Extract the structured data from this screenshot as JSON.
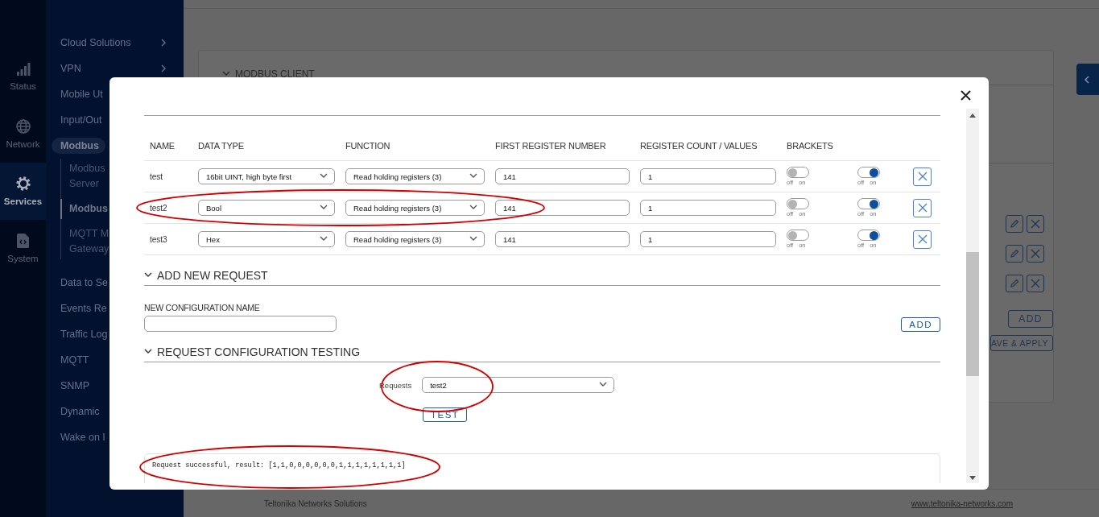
{
  "rail": [
    {
      "label": "Status",
      "selected": false
    },
    {
      "label": "Network",
      "selected": false
    },
    {
      "label": "Services",
      "selected": true
    },
    {
      "label": "System",
      "selected": false
    }
  ],
  "sidebar": {
    "items": [
      {
        "label": "Cloud Solutions",
        "expandable": true,
        "selected": false
      },
      {
        "label": "VPN",
        "expandable": true,
        "selected": false
      },
      {
        "label": "Mobile Ut",
        "selected": false
      },
      {
        "label": "Input/Out",
        "selected": false
      },
      {
        "label": "Modbus",
        "selected": true,
        "children": [
          {
            "label": "Modbus\nServer",
            "selected": false
          },
          {
            "label": "Modbus",
            "selected": true
          },
          {
            "label": "MQTT M\nGateway",
            "selected": false
          }
        ]
      },
      {
        "label": "Data to Se",
        "selected": false
      },
      {
        "label": "Events Re",
        "selected": false
      },
      {
        "label": "Traffic Log",
        "selected": false
      },
      {
        "label": "MQTT",
        "selected": false
      },
      {
        "label": "SNMP",
        "selected": false
      },
      {
        "label": "Dynamic",
        "selected": false
      },
      {
        "label": "Wake on I",
        "selected": false
      }
    ]
  },
  "background_page": {
    "section_title": "MODBUS CLIENT",
    "buttons": [
      "ADD",
      "AVE & APPLY"
    ]
  },
  "footer": {
    "company": "Teltonika Networks Solutions",
    "link": "www.teltonika-networks.com"
  },
  "modal": {
    "table": {
      "columns": [
        "NAME",
        "DATA TYPE",
        "FUNCTION",
        "FIRST REGISTER NUMBER",
        "REGISTER COUNT / VALUES",
        "BRACKETS"
      ],
      "rows": [
        {
          "name": "test",
          "data_type": "16bit UINT, high byte first",
          "function": "Read holding registers (3)",
          "first_register": "141",
          "register_count": "1",
          "brackets": {
            "on": false,
            "off_label": "off",
            "on_label": "on"
          },
          "enabled": {
            "on": true,
            "off_label": "off",
            "on_label": "on"
          }
        },
        {
          "name": "test2",
          "data_type": "Bool",
          "function": "Read holding registers (3)",
          "first_register": "141",
          "register_count": "1",
          "brackets": {
            "on": false,
            "off_label": "off",
            "on_label": "on"
          },
          "enabled": {
            "on": true,
            "off_label": "off",
            "on_label": "on"
          }
        },
        {
          "name": "test3",
          "data_type": "Hex",
          "function": "Read holding registers (3)",
          "first_register": "141",
          "register_count": "1",
          "brackets": {
            "on": false,
            "off_label": "off",
            "on_label": "on"
          },
          "enabled": {
            "on": true,
            "off_label": "off",
            "on_label": "on"
          }
        }
      ]
    },
    "add_section": {
      "title": "ADD NEW REQUEST",
      "expanded": true,
      "field_label": "NEW CONFIGURATION NAME",
      "button": "ADD"
    },
    "testing_section": {
      "title": "REQUEST CONFIGURATION TESTING",
      "expanded": true,
      "select_label": "Requests",
      "select_value": "test2",
      "button": "TEST",
      "result": "Request successful, result: [1,1,0,0,0,0,0,0,1,1,1,1,1,1,1,1]"
    }
  }
}
